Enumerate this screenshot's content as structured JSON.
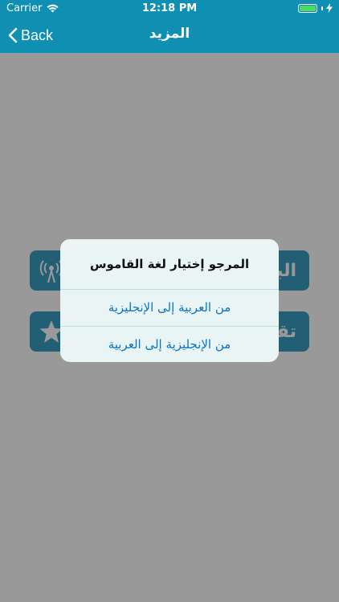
{
  "status_bar": {
    "carrier": "Carrier",
    "time": "12:18 PM"
  },
  "nav": {
    "back_label": "Back",
    "title": "المزيد"
  },
  "menu_buttons": [
    {
      "label": "البـ",
      "icon": "radio-tower-icon"
    },
    {
      "label": "تقـ",
      "icon": "star-icon"
    }
  ],
  "alert": {
    "title": "المرجو إختيار لغة القاموس",
    "actions": [
      "من العربية إلى الإنجليزية",
      "من الإنجليزية إلى العربية"
    ]
  },
  "colors": {
    "nav_bg": "#0f8fb1",
    "button_bg": "#3a9fc4",
    "link": "#0a73c4"
  }
}
